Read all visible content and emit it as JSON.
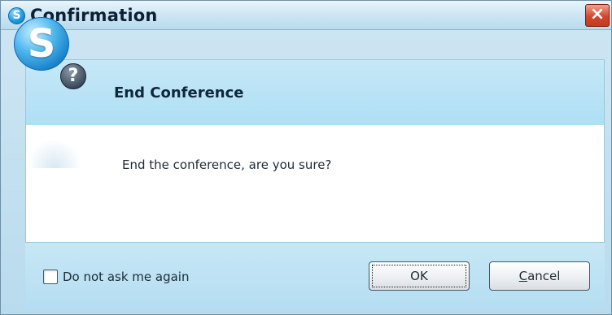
{
  "window": {
    "title": "Confirmation",
    "app_icon_glyph": "S",
    "close_glyph": "×"
  },
  "dialog": {
    "heading": "End Conference",
    "message": "End the conference, are you sure?",
    "logo_letter": "S",
    "badge_glyph": "?",
    "icons": [
      "skype-logo-icon",
      "question-badge-icon"
    ]
  },
  "footer": {
    "checkbox_label": "Do not ask me again",
    "checkbox_checked": false,
    "ok_label": "OK",
    "cancel_label_underlined": "C",
    "cancel_label_rest": "ancel"
  },
  "colors": {
    "header_band": "#aedff4",
    "title_bar": "#cfe7f4",
    "close_button": "#d2472d",
    "accent_blue": "#137cc4"
  }
}
